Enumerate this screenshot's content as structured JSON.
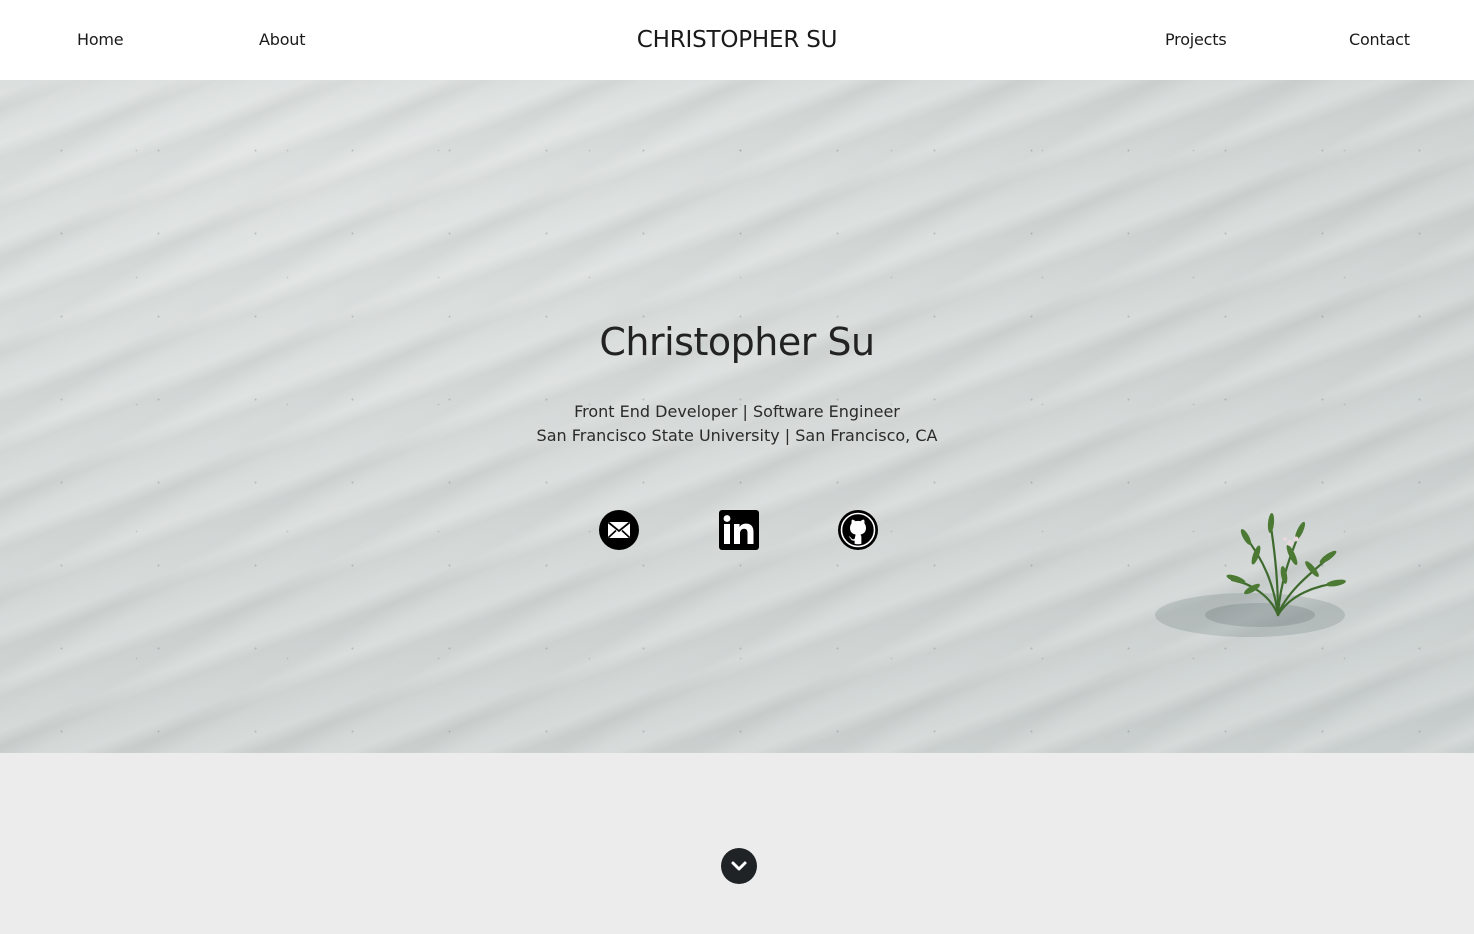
{
  "nav": {
    "home": "Home",
    "about": "About",
    "brand": "CHRISTOPHER SU",
    "projects": "Projects",
    "contact": "Contact"
  },
  "hero": {
    "name": "Christopher Su",
    "line1": "Front End Developer | Software Engineer",
    "line2": "San Francisco State University | San Francisco, CA",
    "social": [
      {
        "icon": "mail-icon"
      },
      {
        "icon": "linkedin-icon"
      },
      {
        "icon": "github-icon"
      }
    ]
  },
  "scroll": {
    "icon": "chevron-down-icon"
  },
  "colors": {
    "nav_bg": "#ffffff",
    "text": "#222222",
    "lower_bg": "#ececec",
    "scroll_btn": "#1f2326"
  }
}
